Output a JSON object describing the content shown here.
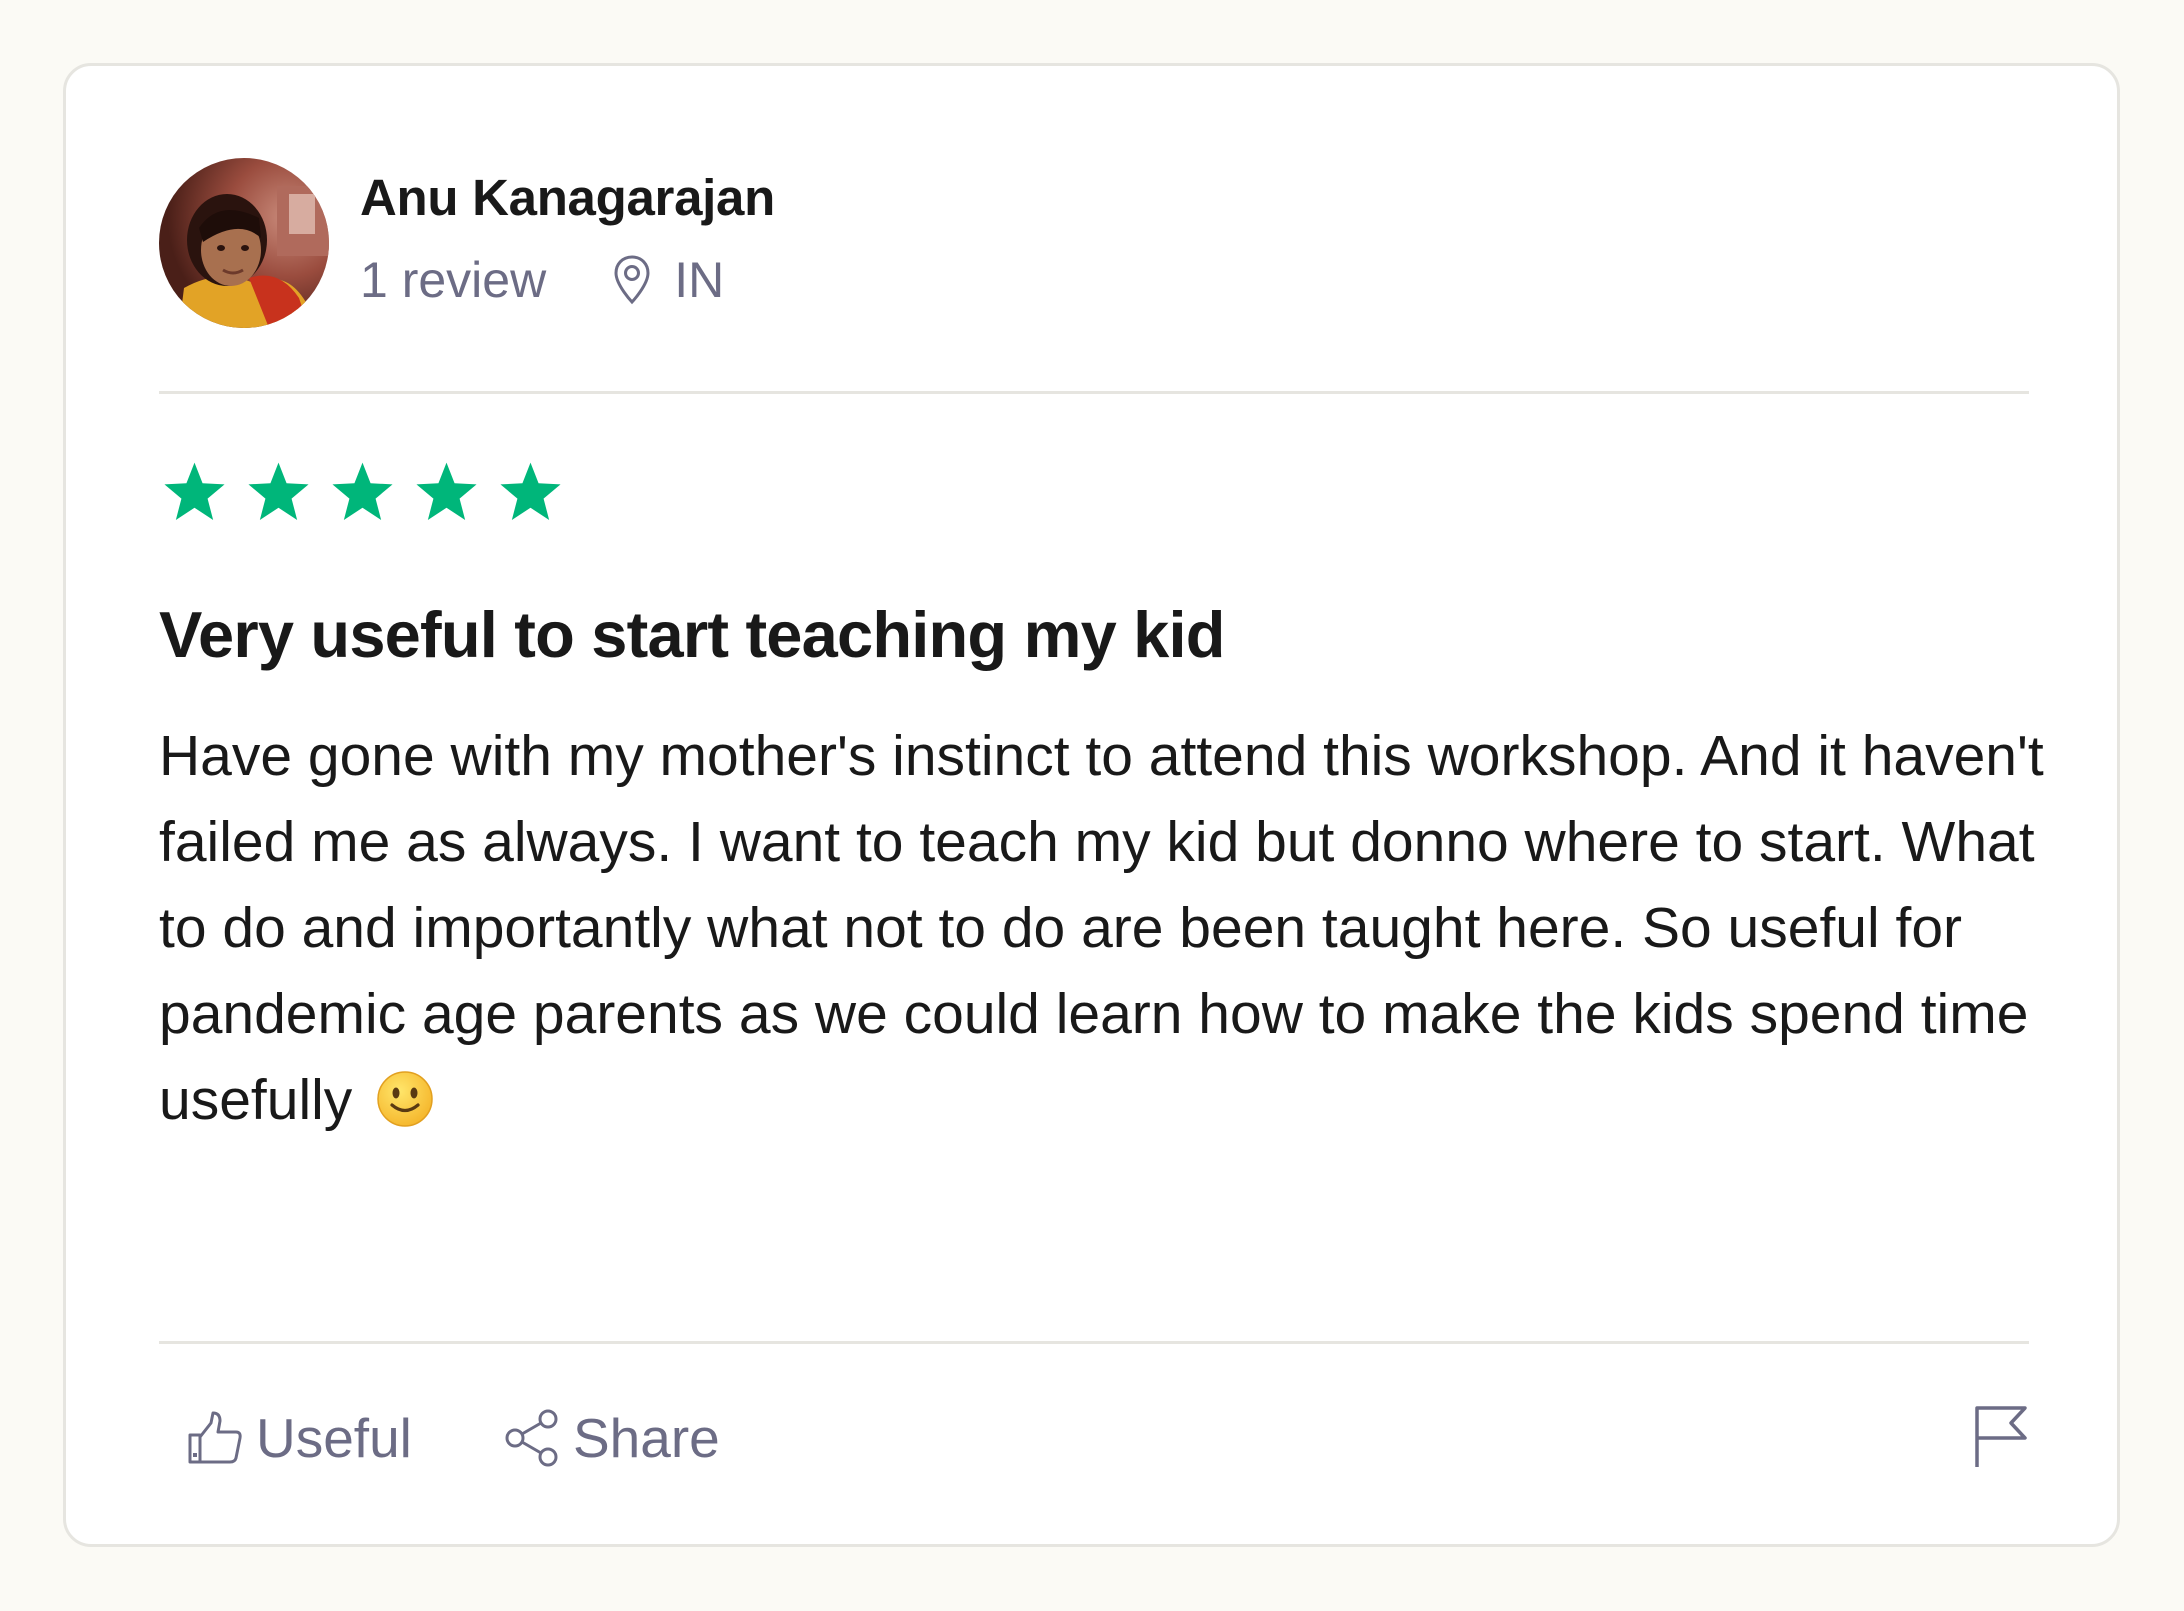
{
  "reviewer": {
    "name": "Anu Kanagarajan",
    "review_count": "1 review",
    "location": "IN",
    "avatar_icon": "user-avatar-photo"
  },
  "review": {
    "rating": 5,
    "max_rating": 5,
    "star_color": "#00b67a",
    "title": "Very useful to start teaching my kid",
    "body": "Have gone with my mother's instinct to attend this workshop. And it haven't failed me as always. I want to teach my kid but donno where to start. What to do and importantly what not to do are been taught here. So useful for pandemic age parents as we could learn how to make the kids spend time usefully",
    "emoji": "slightly-smiling-face"
  },
  "actions": {
    "useful_label": "Useful",
    "useful_icon": "thumbs-up-icon",
    "share_label": "Share",
    "share_icon": "share-icon",
    "report_icon": "flag-icon"
  }
}
